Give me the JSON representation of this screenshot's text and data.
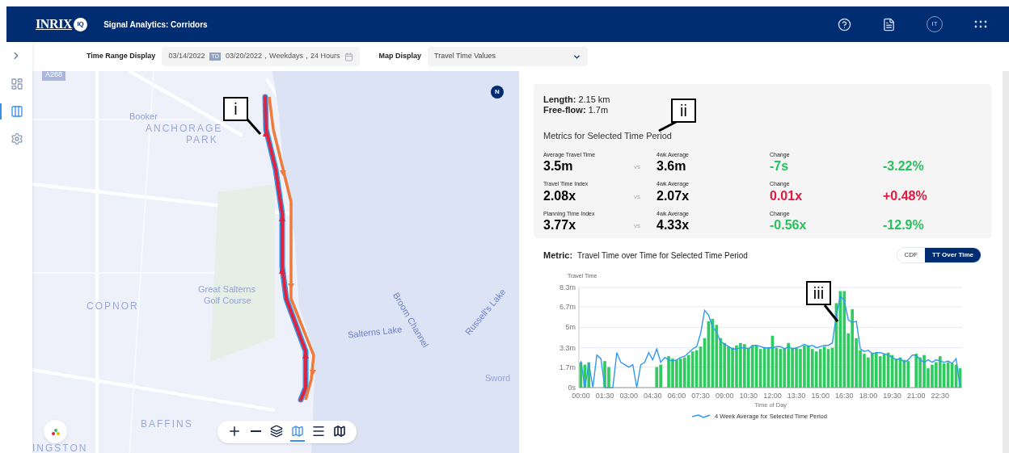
{
  "header": {
    "logo": "INRIX",
    "logo_badge": "IQ",
    "title": "Signal Analytics: Corridors",
    "avatar": "IT"
  },
  "sidebar": {
    "items": [
      {
        "kind": "dashboard",
        "selected": false
      },
      {
        "kind": "corridor",
        "selected": true
      },
      {
        "kind": "settings",
        "selected": false
      }
    ]
  },
  "toolbar": {
    "time_range_label": "Time Range Display",
    "start_date": "03/14/2022",
    "to_badge": "TO",
    "range_text": "03/20/2022，Weekdays，24 Hours",
    "map_display_label": "Map Display",
    "map_display_value": "Travel Time Values"
  },
  "map": {
    "labels": [
      {
        "text": "A288",
        "kind": "road"
      },
      {
        "text": "Booker",
        "kind": "place"
      },
      {
        "text": "ANCHORAGE",
        "kind": "area"
      },
      {
        "text": "PARK",
        "kind": "area"
      },
      {
        "text": "COPNOR",
        "kind": "area"
      },
      {
        "text": "Great Salterns",
        "kind": "place"
      },
      {
        "text": "Golf Course",
        "kind": "place"
      },
      {
        "text": "Salterns Lake",
        "kind": "water"
      },
      {
        "text": "Broom Channel",
        "kind": "water"
      },
      {
        "text": "Russell's Lake",
        "kind": "water"
      },
      {
        "text": "Sword",
        "kind": "place"
      },
      {
        "text": "BAFFINS",
        "kind": "area"
      },
      {
        "text": "INGSTON",
        "kind": "area"
      }
    ],
    "compass": "N",
    "tools": [
      {
        "kind": "zoom-in",
        "selected": false
      },
      {
        "kind": "zoom-out",
        "selected": false
      },
      {
        "kind": "layers",
        "selected": false
      },
      {
        "kind": "map",
        "selected": true
      },
      {
        "kind": "list",
        "selected": false
      },
      {
        "kind": "legend",
        "selected": false
      }
    ]
  },
  "summary": {
    "length_label": "Length:",
    "length": "2.15 km",
    "freeflow_label": "Free-flow:",
    "freeflow": "1.7m",
    "metrics_title": "Metrics for Selected Time Period",
    "metrics": [
      {
        "label": "Average Travel Time",
        "value": "3.5m",
        "vs": "vs",
        "avg_label": "4wk Average",
        "avg": "3.6m",
        "change_label": "Change",
        "change": "-7s",
        "percent": "-3.22%",
        "worse": false
      },
      {
        "label": "Travel Time Index",
        "value": "2.08x",
        "vs": "vs",
        "avg_label": "4wk Average",
        "avg": "2.07x",
        "change_label": "Change",
        "change": "0.01x",
        "percent": "+0.48%",
        "worse": true
      },
      {
        "label": "Planning Time Index",
        "value": "3.77x",
        "vs": "vs",
        "avg_label": "4wk Average",
        "avg": "4.33x",
        "change_label": "Change",
        "change": "-0.56x",
        "percent": "-12.9%",
        "worse": false
      }
    ]
  },
  "metric_panel": {
    "label": "Metric:",
    "title": "Travel Time over Time for Selected Time Period",
    "toggles": [
      {
        "label": "CDF",
        "selected": false
      },
      {
        "label": "TT Over Time",
        "selected": true
      }
    ],
    "chart_data": {
      "type": "bar",
      "ylabel": "Travel Time",
      "xlabel": "Time of Day",
      "ylim": [
        0,
        8.3
      ],
      "xlim": [
        -0.125,
        23.875
      ],
      "grid": true,
      "yticks": [
        {
          "value": 0,
          "label": "0s"
        },
        {
          "value": 1.7,
          "label": "1.7m"
        },
        {
          "value": 3.3,
          "label": "3.3m"
        },
        {
          "value": 5,
          "label": "5m"
        },
        {
          "value": 6.7,
          "label": "6.7m"
        },
        {
          "value": 8.3,
          "label": "8.3m"
        }
      ],
      "xticks": [
        {
          "value": 0,
          "label": "00:00"
        },
        {
          "value": 1.5,
          "label": "01:30"
        },
        {
          "value": 3,
          "label": "03:00"
        },
        {
          "value": 4.5,
          "label": "04:30"
        },
        {
          "value": 6,
          "label": "06:00"
        },
        {
          "value": 7.5,
          "label": "07:30"
        },
        {
          "value": 9,
          "label": "09:00"
        },
        {
          "value": 10.5,
          "label": "10:30"
        },
        {
          "value": 12,
          "label": "12:00"
        },
        {
          "value": 13.5,
          "label": "13:30"
        },
        {
          "value": 15,
          "label": "15:00"
        },
        {
          "value": 16.5,
          "label": "16:30"
        },
        {
          "value": 18,
          "label": "18:00"
        },
        {
          "value": 19.5,
          "label": "19:30"
        },
        {
          "value": 21,
          "label": "21:00"
        },
        {
          "value": 22.5,
          "label": "22:30"
        }
      ],
      "x": [
        0,
        0.25,
        0.5,
        0.75,
        1,
        1.25,
        1.5,
        1.75,
        2,
        2.25,
        2.5,
        2.75,
        3,
        3.25,
        3.5,
        3.75,
        4,
        4.25,
        4.5,
        4.75,
        5,
        5.25,
        5.5,
        5.75,
        6,
        6.25,
        6.5,
        6.75,
        7,
        7.25,
        7.5,
        7.75,
        8,
        8.25,
        8.5,
        8.75,
        9,
        9.25,
        9.5,
        9.75,
        10,
        10.25,
        10.5,
        10.75,
        11,
        11.25,
        11.5,
        11.75,
        12,
        12.25,
        12.5,
        12.75,
        13,
        13.25,
        13.5,
        13.75,
        14,
        14.25,
        14.5,
        14.75,
        15,
        15.25,
        15.5,
        15.75,
        16,
        16.25,
        16.5,
        16.75,
        17,
        17.25,
        17.5,
        17.75,
        18,
        18.25,
        18.5,
        18.75,
        19,
        19.25,
        19.5,
        19.75,
        20,
        20.25,
        20.5,
        20.75,
        21,
        21.25,
        21.5,
        21.75,
        22,
        22.25,
        22.5,
        22.75,
        23,
        23.25,
        23.5,
        23.75
      ],
      "series": [
        {
          "type": "bar",
          "color": "#2ecc5f",
          "values": [
            2.1,
            1.9,
            2.1,
            null,
            null,
            null,
            2.2,
            1.7,
            null,
            null,
            null,
            null,
            null,
            null,
            null,
            null,
            null,
            null,
            null,
            1.7,
            1.9,
            null,
            2.6,
            2.4,
            2.3,
            2.4,
            2.5,
            2.7,
            3.0,
            3.1,
            3.4,
            4.1,
            5.5,
            5.7,
            5.2,
            4.1,
            3.7,
            3.4,
            3.3,
            3.5,
            3.7,
            3.6,
            3.3,
            3.5,
            3.5,
            3.2,
            3.3,
            3.3,
            4.3,
            3.3,
            3.2,
            3.3,
            3.7,
            3.3,
            3.3,
            3.2,
            3.5,
            3.5,
            3.2,
            3.0,
            3.2,
            3.4,
            3.2,
            3.3,
            7.0,
            8.0,
            8.0,
            4.5,
            6.5,
            4.1,
            3.1,
            2.8,
            2.5,
            2.9,
            2.9,
            2.6,
            2.8,
            2.9,
            2.7,
            2.4,
            2.5,
            2.3,
            2.2,
            null,
            2.8,
            2.5,
            2.7,
            1.6,
            1.9,
            2.1,
            2.6,
            2.0,
            2.1,
            2.0,
            1.9,
            1.6
          ]
        },
        {
          "type": "line",
          "name": "4 Week Average for Selected Time Period",
          "color": "#3399ee",
          "values": [
            2.2,
            0,
            2.0,
            0,
            2.7,
            2.4,
            0,
            0,
            0,
            2.9,
            2.1,
            1.9,
            1.7,
            1.9,
            0,
            1.9,
            2.1,
            2.9,
            2.3,
            3.2,
            2.1,
            2.5,
            2.3,
            2.2,
            2.3,
            2.5,
            2.6,
            2.9,
            3.2,
            3.4,
            4.5,
            6.4,
            6.0,
            5.0,
            4.6,
            3.8,
            3.6,
            3.4,
            3.2,
            3.2,
            3.3,
            3.3,
            3.2,
            3.5,
            3.5,
            3.4,
            3.3,
            3.3,
            3.3,
            3.4,
            3.4,
            3.2,
            3.4,
            3.2,
            3.3,
            3.4,
            3.6,
            3.4,
            3.5,
            3.3,
            3.4,
            3.5,
            3.5,
            3.7,
            6.0,
            7.6,
            7.2,
            5.6,
            5.4,
            5.5,
            3.2,
            3.0,
            3.1,
            2.8,
            2.9,
            2.9,
            2.8,
            2.7,
            2.5,
            2.3,
            2.4,
            2.1,
            2.3,
            2.7,
            2.7,
            2.3,
            2.1,
            2.3,
            2.1,
            2.3,
            2.2,
            2.1,
            2.2,
            2.0,
            2.4,
            0
          ]
        }
      ]
    }
  },
  "callouts": [
    {
      "text": "i"
    },
    {
      "text": "ii"
    },
    {
      "text": "iii"
    }
  ]
}
